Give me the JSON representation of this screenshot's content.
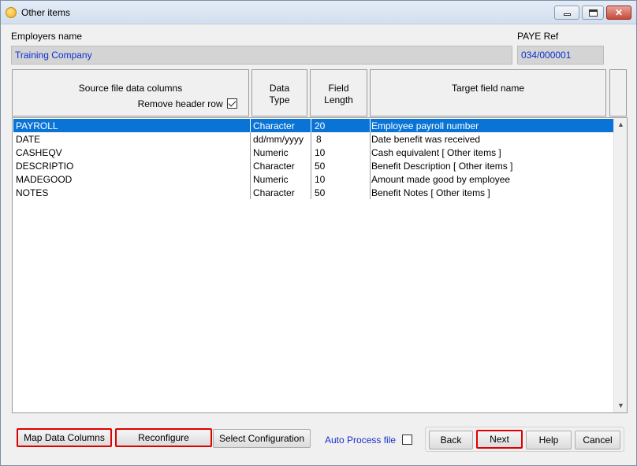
{
  "window": {
    "title": "Other items",
    "icon": "app-gear-icon"
  },
  "employer": {
    "label": "Employers name",
    "value": "Training Company"
  },
  "paye": {
    "label": "PAYE Ref",
    "value": "034/000001"
  },
  "columns": {
    "source": "Source file data columns",
    "remove_header": "Remove header row",
    "remove_header_checked": true,
    "data_type": "Data\nType",
    "data_type_l1": "Data",
    "data_type_l2": "Type",
    "field_length_l1": "Field",
    "field_length_l2": "Length",
    "target": "Target field name"
  },
  "rows": [
    {
      "source": "PAYROLL",
      "type": "Character",
      "length": "20",
      "target": "Employee payroll number"
    },
    {
      "source": "DATE",
      "type": "dd/mm/yyyy",
      "length": "8",
      "target": "Date benefit was received"
    },
    {
      "source": "CASHEQV",
      "type": "Numeric",
      "length": "10",
      "target": "Cash equivalent [ Other items ]"
    },
    {
      "source": "DESCRIPTIO",
      "type": "Character",
      "length": "50",
      "target": "Benefit Description [ Other items ]"
    },
    {
      "source": "MADEGOOD",
      "type": "Numeric",
      "length": "10",
      "target": "Amount made good by employee"
    },
    {
      "source": "NOTES",
      "type": "Character",
      "length": "50",
      "target": "Benefit Notes [ Other items ]"
    }
  ],
  "buttons": {
    "map": "Map Data Columns",
    "reconfigure": "Reconfigure",
    "select_config": "Select Configuration",
    "auto_process": "Auto Process file",
    "back": "Back",
    "next": "Next",
    "help": "Help",
    "cancel": "Cancel"
  },
  "colors": {
    "selection": "#0a74d6",
    "highlight": "#e00000",
    "link": "#1b2fcc"
  }
}
